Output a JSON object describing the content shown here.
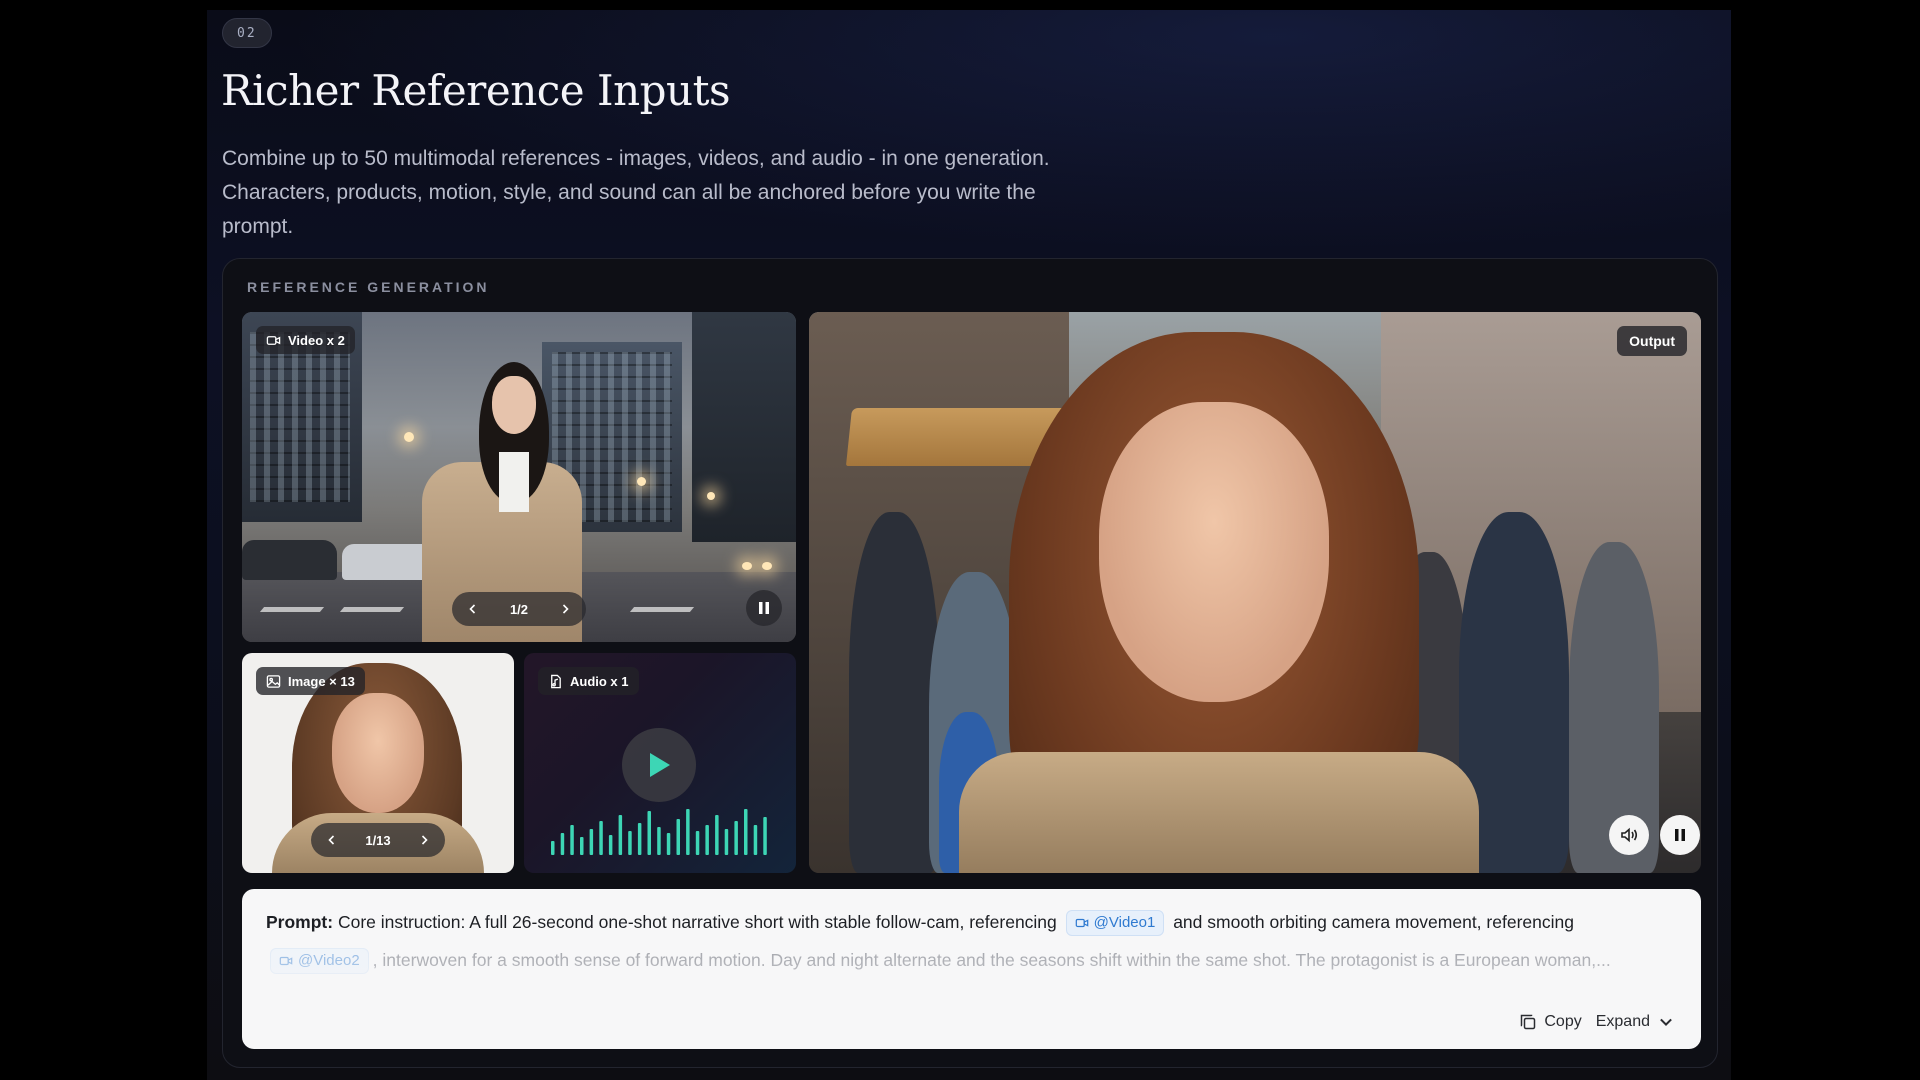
{
  "section": {
    "number": "02",
    "title": "Richer Reference Inputs",
    "description": "Combine up to 50 multimodal references - images, videos, and audio - in one generation. Characters, products, motion, style, and sound can all be anchored before you write the prompt."
  },
  "panel": {
    "label": "REFERENCE GENERATION",
    "video_card": {
      "chip": "Video x 2",
      "pager": "1/2",
      "icon": "video-camera-icon"
    },
    "image_card": {
      "chip": "Image × 13",
      "pager": "1/13",
      "icon": "image-icon"
    },
    "audio_card": {
      "chip": "Audio x 1",
      "icon": "audio-file-icon"
    },
    "output_card": {
      "chip": "Output"
    }
  },
  "prompt": {
    "label": "Prompt:",
    "line1_text": "Core instruction: A full 26-second one-shot narrative short with stable follow-cam, referencing",
    "ref1": "@Video1",
    "line1_tail": "and smooth orbiting camera movement, referencing",
    "ref2": "@Video2",
    "line2_text": ", interwoven for a smooth sense of forward motion. Day and night alternate and the seasons shift within the same shot. The protagonist is a European woman,...",
    "copy_label": "Copy",
    "expand_label": "Expand"
  },
  "colors": {
    "accent_teal": "#3dd6b5",
    "ref_tag_blue": "#2f7ad0"
  }
}
